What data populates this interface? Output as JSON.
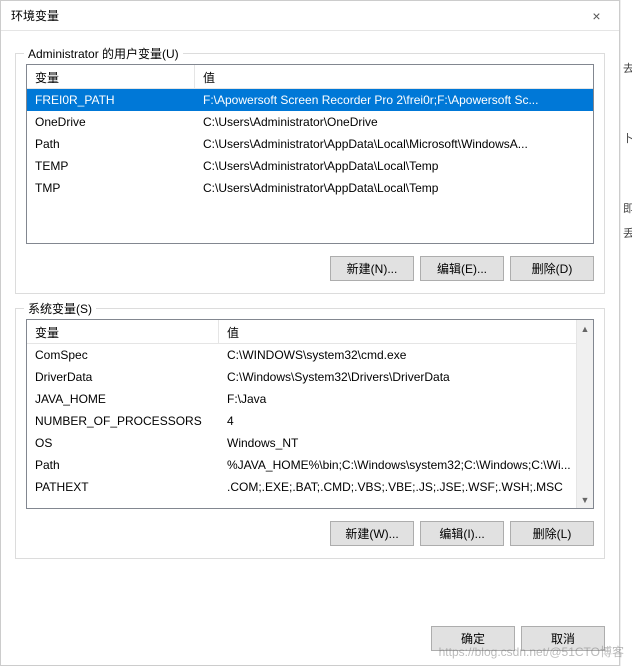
{
  "dialog": {
    "title": "环境变量",
    "close_icon": "×"
  },
  "user_vars": {
    "group_label": "Administrator 的用户变量(U)",
    "header_var": "变量",
    "header_val": "值",
    "rows": [
      {
        "name": "FREI0R_PATH",
        "value": "F:\\Apowersoft Screen Recorder Pro 2\\frei0r;F:\\Apowersoft Sc...",
        "selected": true
      },
      {
        "name": "OneDrive",
        "value": "C:\\Users\\Administrator\\OneDrive",
        "selected": false
      },
      {
        "name": "Path",
        "value": "C:\\Users\\Administrator\\AppData\\Local\\Microsoft\\WindowsA...",
        "selected": false
      },
      {
        "name": "TEMP",
        "value": "C:\\Users\\Administrator\\AppData\\Local\\Temp",
        "selected": false
      },
      {
        "name": "TMP",
        "value": "C:\\Users\\Administrator\\AppData\\Local\\Temp",
        "selected": false
      }
    ],
    "btn_new": "新建(N)...",
    "btn_edit": "编辑(E)...",
    "btn_delete": "删除(D)"
  },
  "sys_vars": {
    "group_label": "系统变量(S)",
    "header_var": "变量",
    "header_val": "值",
    "rows": [
      {
        "name": "ComSpec",
        "value": "C:\\WINDOWS\\system32\\cmd.exe"
      },
      {
        "name": "DriverData",
        "value": "C:\\Windows\\System32\\Drivers\\DriverData"
      },
      {
        "name": "JAVA_HOME",
        "value": "F:\\Java"
      },
      {
        "name": "NUMBER_OF_PROCESSORS",
        "value": "4"
      },
      {
        "name": "OS",
        "value": "Windows_NT"
      },
      {
        "name": "Path",
        "value": "%JAVA_HOME%\\bin;C:\\Windows\\system32;C:\\Windows;C:\\Wi..."
      },
      {
        "name": "PATHEXT",
        "value": ".COM;.EXE;.BAT;.CMD;.VBS;.VBE;.JS;.JSE;.WSF;.WSH;.MSC"
      }
    ],
    "btn_new": "新建(W)...",
    "btn_edit": "编辑(I)...",
    "btn_delete": "删除(L)"
  },
  "footer": {
    "ok": "确定",
    "cancel": "取消"
  },
  "watermark": "https://blog.csdn.net/@51CTO博客",
  "right_glyphs": {
    "a": "去",
    "b": "卜",
    "c": "即",
    "d": "丢"
  }
}
